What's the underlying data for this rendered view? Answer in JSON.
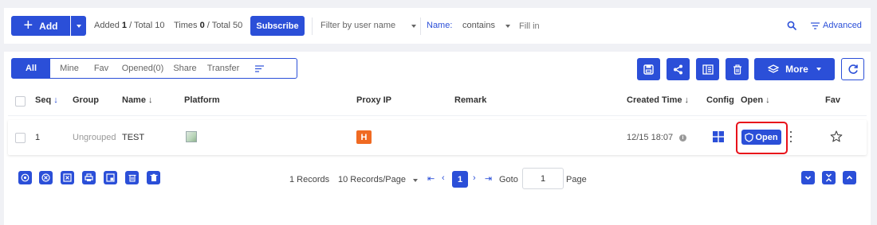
{
  "toolbar": {
    "add_label": "Add",
    "added_label": "Added",
    "added_count": "1",
    "added_total": "/ Total 10",
    "times_label": "Times",
    "times_count": "0",
    "times_total": "/ Total 50",
    "subscribe_label": "Subscribe",
    "filter_user_placeholder": "Filter by user name",
    "name_label": "Name:",
    "contains_label": "contains",
    "fill_placeholder": "Fill in",
    "advanced_label": "Advanced"
  },
  "tabs": [
    {
      "label": "All",
      "active": true
    },
    {
      "label": "Mine"
    },
    {
      "label": "Fav"
    },
    {
      "label": "Opened(0)"
    },
    {
      "label": "Share"
    },
    {
      "label": "Transfer"
    }
  ],
  "actions": {
    "more_label": "More",
    "icons": [
      "save-icon",
      "share-icon",
      "columns-icon",
      "trash-icon",
      "layers-icon",
      "refresh-icon"
    ]
  },
  "table": {
    "columns": [
      "Seq",
      "Group",
      "Name",
      "Platform",
      "Proxy IP",
      "Remark",
      "Created Time",
      "Config",
      "Open",
      "Fav"
    ],
    "rows": [
      {
        "seq": "1",
        "group": "Ungrouped",
        "name": "TEST",
        "platform_icon": "broken-image-icon",
        "proxy_badge": "H",
        "remark": "",
        "created_time": "12/15 18:07",
        "config_icon": "windows-icon",
        "open_label": "Open",
        "fav_icon": "star-outline-icon"
      }
    ]
  },
  "pagination": {
    "records": "1 Records",
    "per_page": "10 Records/Page",
    "current_page": "1",
    "goto_label": "Goto",
    "goto_value": "1",
    "page_label": "Page"
  },
  "colors": {
    "primary": "#2b4fd8",
    "proxy_badge": "#f06a22",
    "highlight_border": "#e8101a",
    "background": "#f0f1f5"
  }
}
